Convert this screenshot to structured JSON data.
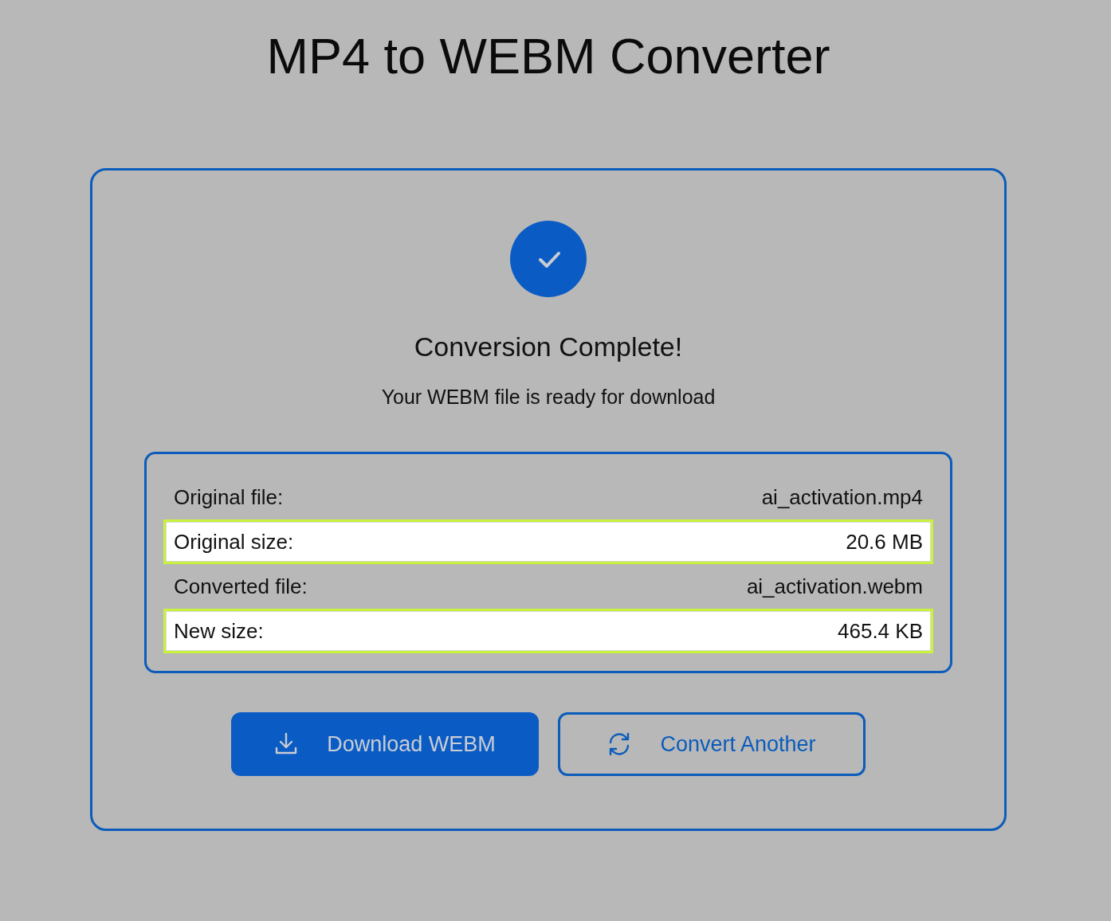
{
  "title": "MP4 to WEBM Converter",
  "status": {
    "heading": "Conversion Complete!",
    "message": "Your WEBM file is ready for download"
  },
  "details": [
    {
      "label": "Original file:",
      "value": "ai_activation.mp4",
      "highlighted": false
    },
    {
      "label": "Original size:",
      "value": "20.6 MB",
      "highlighted": true
    },
    {
      "label": "Converted file:",
      "value": "ai_activation.webm",
      "highlighted": false
    },
    {
      "label": "New size:",
      "value": "465.4 KB",
      "highlighted": true
    }
  ],
  "buttons": [
    {
      "kind": "download",
      "label": "Download WEBM"
    },
    {
      "kind": "restart",
      "label": "Convert Another"
    }
  ]
}
